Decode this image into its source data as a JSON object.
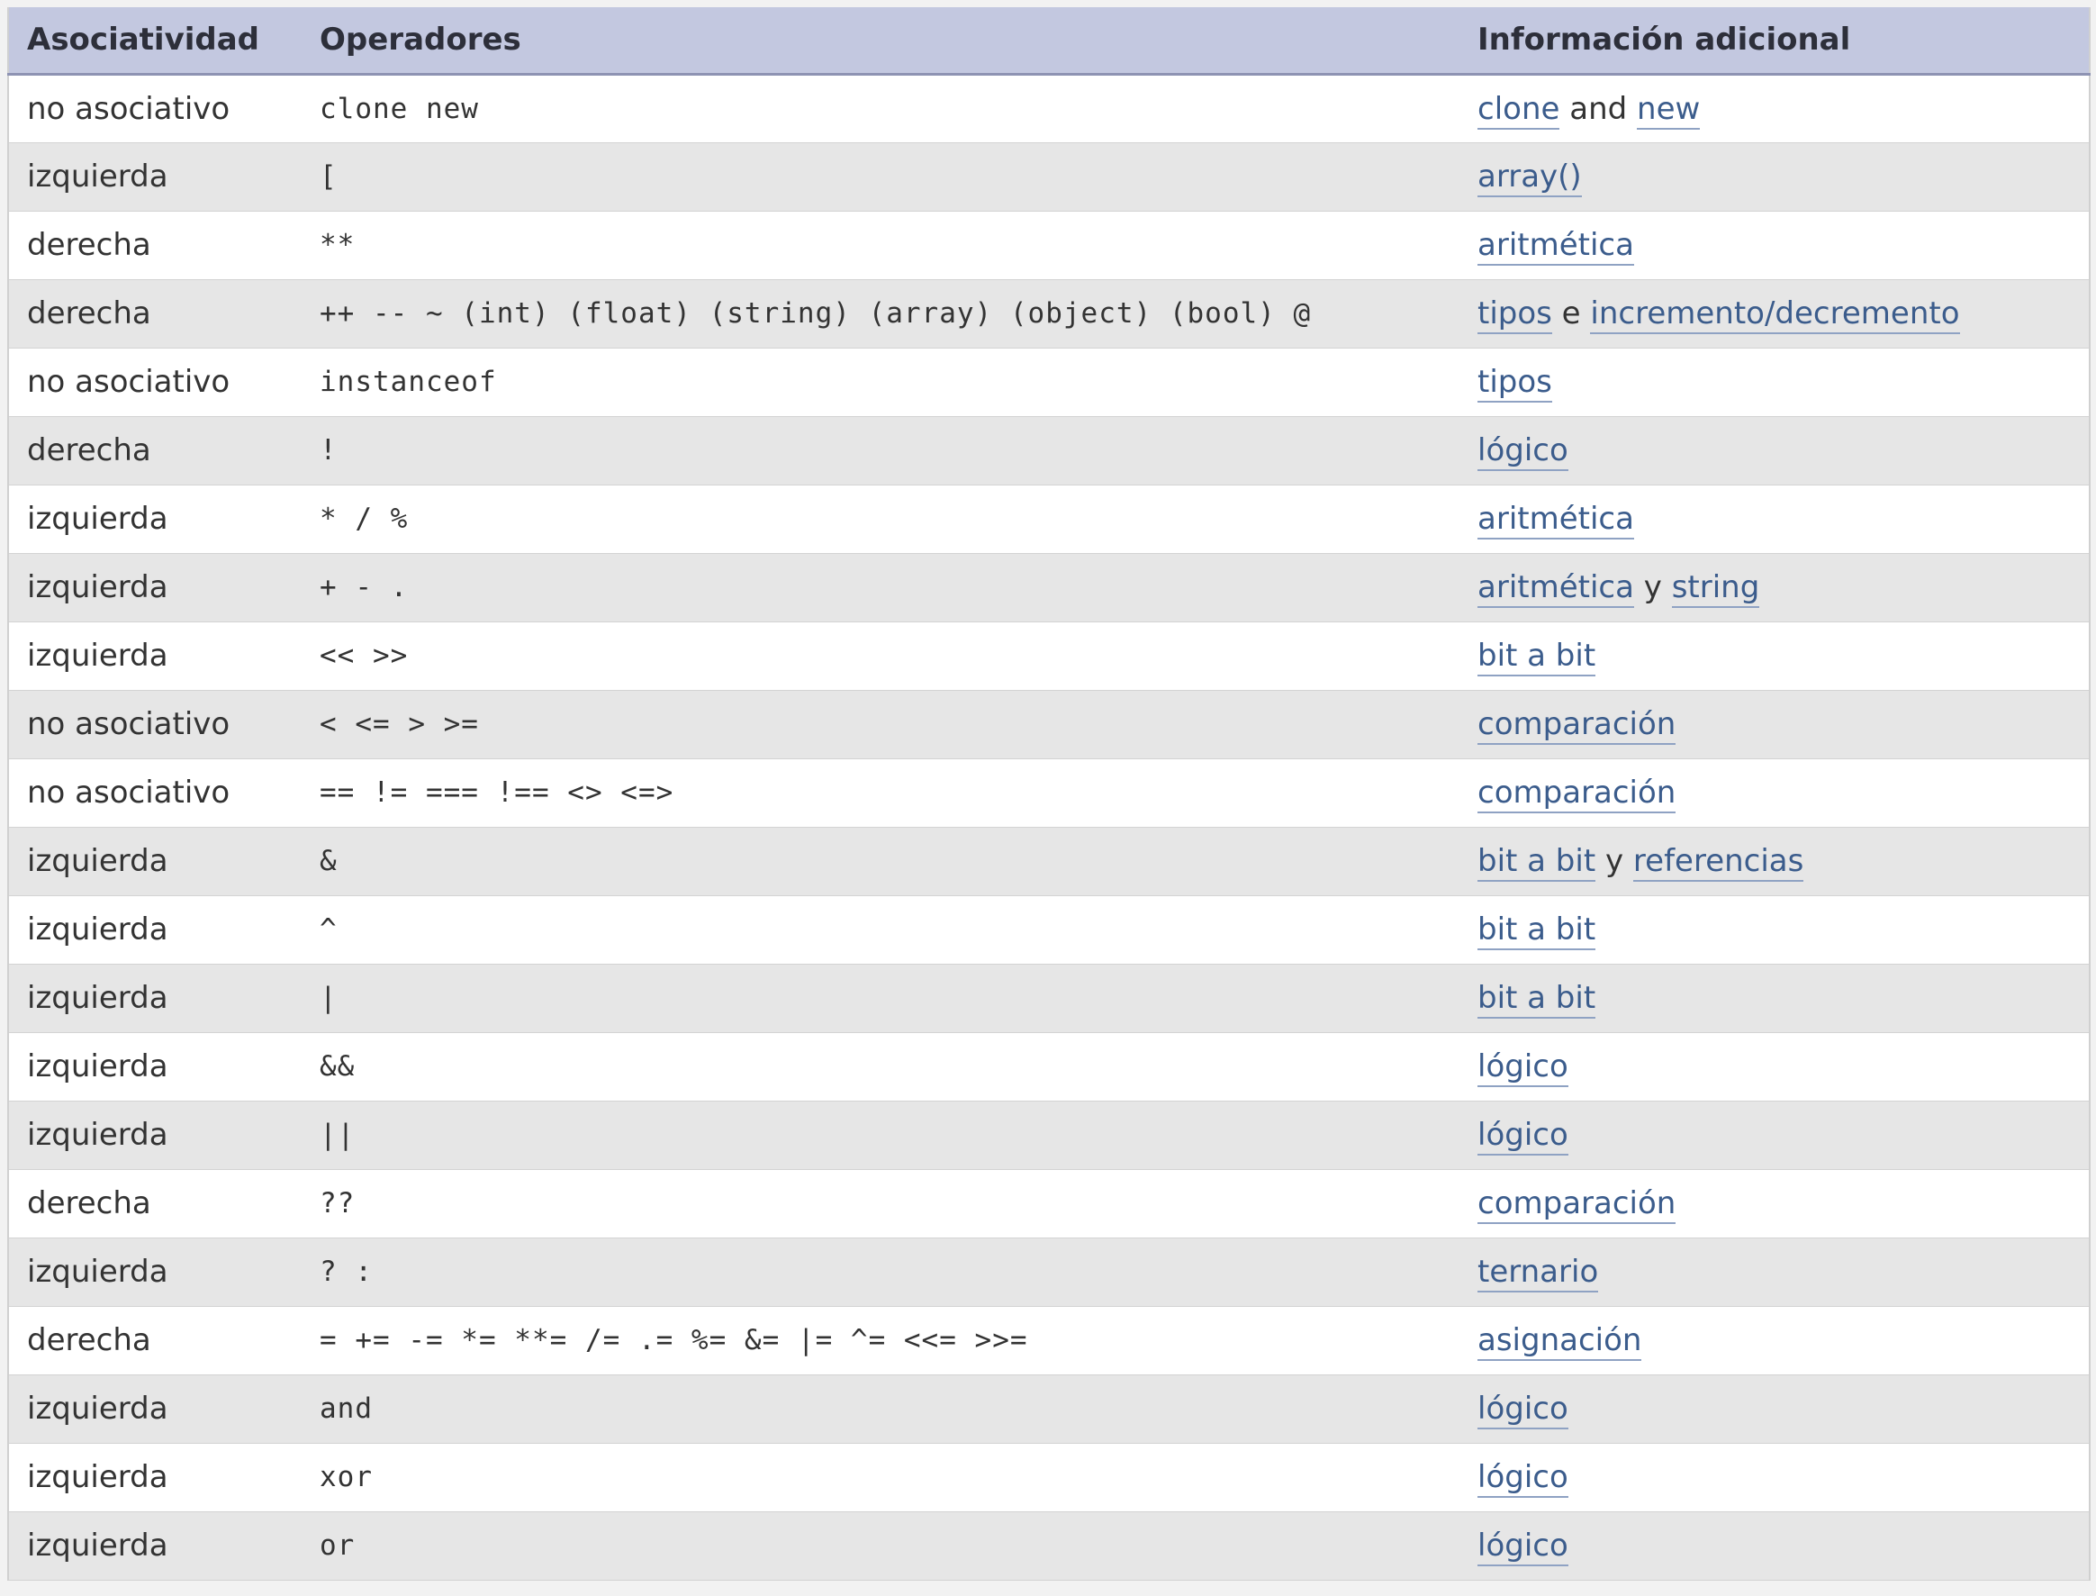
{
  "table": {
    "headers": [
      "Asociatividad",
      "Operadores",
      "Información adicional"
    ],
    "rows": [
      {
        "assoc": "no asociativo",
        "ops": "clone new",
        "info": [
          {
            "t": "clone",
            "link": true
          },
          {
            "t": " and ",
            "link": false
          },
          {
            "t": "new",
            "link": true
          }
        ]
      },
      {
        "assoc": "izquierda",
        "ops": "[",
        "info": [
          {
            "t": "array()",
            "link": true
          }
        ]
      },
      {
        "assoc": "derecha",
        "ops": "**",
        "info": [
          {
            "t": "aritmética",
            "link": true
          }
        ]
      },
      {
        "assoc": "derecha",
        "ops": "++ -- ~ (int) (float) (string) (array) (object) (bool) @",
        "info": [
          {
            "t": "tipos",
            "link": true
          },
          {
            "t": " e ",
            "link": false
          },
          {
            "t": "incremento/decremento",
            "link": true
          }
        ]
      },
      {
        "assoc": "no asociativo",
        "ops": "instanceof",
        "info": [
          {
            "t": "tipos",
            "link": true
          }
        ]
      },
      {
        "assoc": "derecha",
        "ops": "!",
        "info": [
          {
            "t": "lógico",
            "link": true
          }
        ]
      },
      {
        "assoc": "izquierda",
        "ops": "* / %",
        "info": [
          {
            "t": "aritmética",
            "link": true
          }
        ]
      },
      {
        "assoc": "izquierda",
        "ops": "+ - .",
        "info": [
          {
            "t": "aritmética",
            "link": true
          },
          {
            "t": " y ",
            "link": false
          },
          {
            "t": "string",
            "link": true
          }
        ]
      },
      {
        "assoc": "izquierda",
        "ops": "<< >>",
        "info": [
          {
            "t": "bit a bit",
            "link": true
          }
        ]
      },
      {
        "assoc": "no asociativo",
        "ops": "< <= > >=",
        "info": [
          {
            "t": "comparación",
            "link": true
          }
        ]
      },
      {
        "assoc": "no asociativo",
        "ops": "== != === !== <> <=>",
        "info": [
          {
            "t": "comparación",
            "link": true
          }
        ]
      },
      {
        "assoc": "izquierda",
        "ops": "&",
        "info": [
          {
            "t": "bit a bit",
            "link": true
          },
          {
            "t": " y ",
            "link": false
          },
          {
            "t": "referencias",
            "link": true
          }
        ]
      },
      {
        "assoc": "izquierda",
        "ops": "^",
        "info": [
          {
            "t": "bit a bit",
            "link": true
          }
        ]
      },
      {
        "assoc": "izquierda",
        "ops": "|",
        "info": [
          {
            "t": "bit a bit",
            "link": true
          }
        ]
      },
      {
        "assoc": "izquierda",
        "ops": "&&",
        "info": [
          {
            "t": "lógico",
            "link": true
          }
        ]
      },
      {
        "assoc": "izquierda",
        "ops": "||",
        "info": [
          {
            "t": "lógico",
            "link": true
          }
        ]
      },
      {
        "assoc": "derecha",
        "ops": "??",
        "info": [
          {
            "t": "comparación",
            "link": true
          }
        ]
      },
      {
        "assoc": "izquierda",
        "ops": "? :",
        "info": [
          {
            "t": "ternario",
            "link": true
          }
        ]
      },
      {
        "assoc": "derecha",
        "ops": "= += -= *= **= /= .= %= &= |= ^= <<= >>=",
        "info": [
          {
            "t": "asignación",
            "link": true
          }
        ]
      },
      {
        "assoc": "izquierda",
        "ops": "and",
        "info": [
          {
            "t": "lógico",
            "link": true
          }
        ]
      },
      {
        "assoc": "izquierda",
        "ops": "xor",
        "info": [
          {
            "t": "lógico",
            "link": true
          }
        ]
      },
      {
        "assoc": "izquierda",
        "ops": "or",
        "info": [
          {
            "t": "lógico",
            "link": true
          }
        ]
      }
    ]
  },
  "colors": {
    "header_bg": "#c3c8e0",
    "row_even_bg": "#e6e6e6",
    "row_odd_bg": "#ffffff",
    "link": "#3b5c8c"
  }
}
